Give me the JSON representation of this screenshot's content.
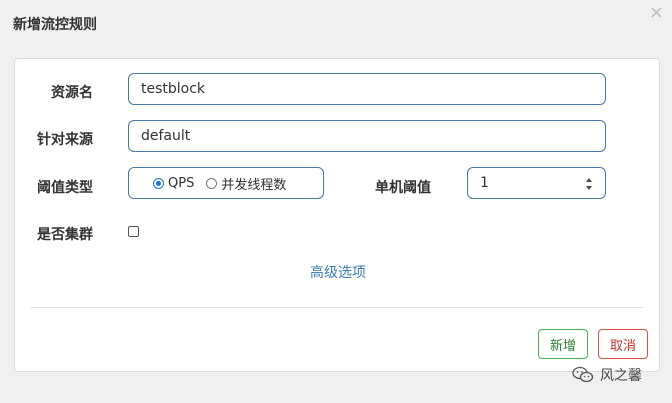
{
  "dialog": {
    "title": "新增流控规则",
    "close_glyph": "×"
  },
  "form": {
    "resource_label": "资源名",
    "resource_value": "testblock",
    "origin_label": "针对来源",
    "origin_value": "default",
    "threshold_type_label": "阈值类型",
    "threshold_type_options": [
      "QPS",
      "并发线程数"
    ],
    "threshold_type_selected": "QPS",
    "single_threshold_label": "单机阈值",
    "single_threshold_value": "1",
    "cluster_label": "是否集群",
    "cluster_checked": false
  },
  "advanced_link": "高级选项",
  "buttons": {
    "add_label": "新增",
    "cancel_label": "取消"
  },
  "watermark": {
    "text": "风之馨",
    "icon": "wechat-icon"
  },
  "colors": {
    "input_border": "#4a78a8",
    "link": "#3a7ab8",
    "add_button": "#4caf50",
    "cancel_button": "#d9534f"
  }
}
